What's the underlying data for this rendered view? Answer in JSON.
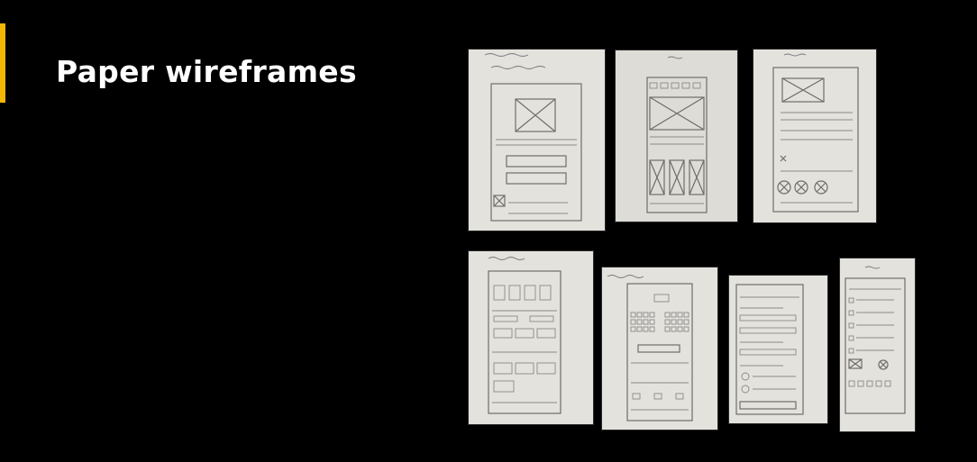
{
  "slide": {
    "title": "Paper wireframes",
    "accent_color": "#f2b705",
    "background_color": "#000000"
  },
  "wireframes": [
    {
      "name": "wireframe-photo-login"
    },
    {
      "name": "wireframe-photo-home"
    },
    {
      "name": "wireframe-photo-detail"
    },
    {
      "name": "wireframe-photo-theatre"
    },
    {
      "name": "wireframe-photo-seats"
    },
    {
      "name": "wireframe-photo-form"
    },
    {
      "name": "wireframe-photo-list"
    }
  ]
}
